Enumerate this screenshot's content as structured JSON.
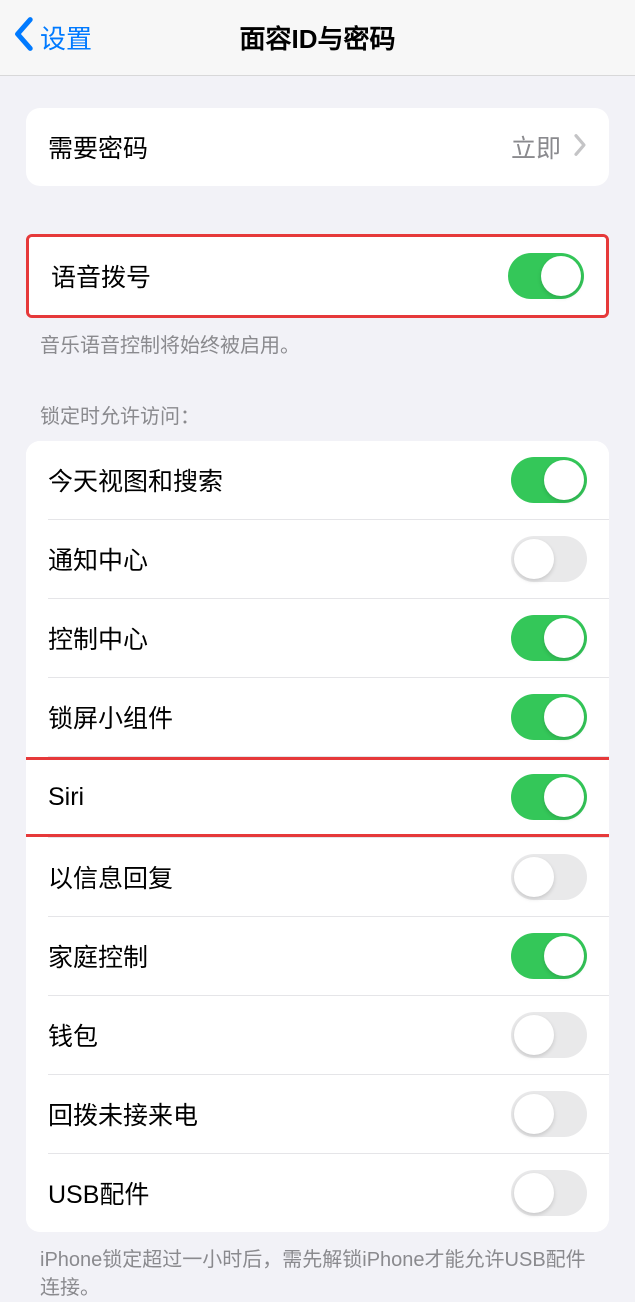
{
  "header": {
    "back": "设置",
    "title": "面容ID与密码"
  },
  "passcode_row": {
    "label": "需要密码",
    "value": "立即"
  },
  "voice_dial": {
    "label": "语音拨号",
    "on": true,
    "footer": "音乐语音控制将始终被启用。"
  },
  "lock_section_header": "锁定时允许访问：",
  "lock_items": [
    {
      "label": "今天视图和搜索",
      "on": true
    },
    {
      "label": "通知中心",
      "on": false
    },
    {
      "label": "控制中心",
      "on": true
    },
    {
      "label": "锁屏小组件",
      "on": true
    },
    {
      "label": "Siri",
      "on": true,
      "highlighted": true
    },
    {
      "label": "以信息回复",
      "on": false
    },
    {
      "label": "家庭控制",
      "on": true
    },
    {
      "label": "钱包",
      "on": false
    },
    {
      "label": "回拨未接来电",
      "on": false
    },
    {
      "label": "USB配件",
      "on": false
    }
  ],
  "usb_footer": "iPhone锁定超过一小时后，需先解锁iPhone才能允许USB配件连接。"
}
